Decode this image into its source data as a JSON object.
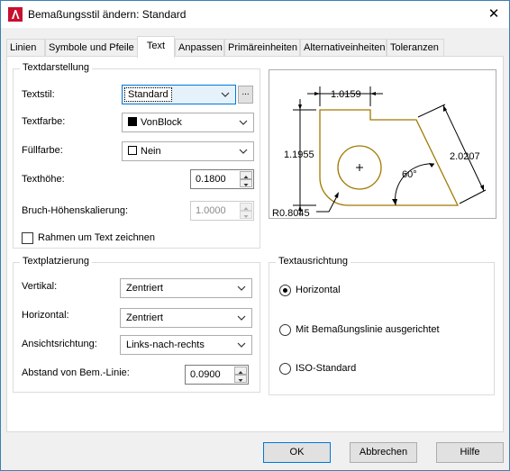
{
  "window": {
    "title": "Bemaßungsstil ändern: Standard",
    "close": "✕",
    "app_icon": "autocad-logo-icon"
  },
  "tabs": [
    {
      "label": "Linien",
      "active": false
    },
    {
      "label": "Symbole und Pfeile",
      "active": false
    },
    {
      "label": "Text",
      "active": true
    },
    {
      "label": "Anpassen",
      "active": false
    },
    {
      "label": "Primäreinheiten",
      "active": false
    },
    {
      "label": "Alternativeinheiten",
      "active": false
    },
    {
      "label": "Toleranzen",
      "active": false
    }
  ],
  "textdarstellung": {
    "title": "Textdarstellung",
    "textstil": {
      "label": "Textstil:",
      "value": "Standard",
      "browse": "..."
    },
    "textfarbe": {
      "label": "Textfarbe:",
      "value": "VonBlock",
      "swatch": "#000000"
    },
    "fuellfarbe": {
      "label": "Füllfarbe:",
      "value": "Nein",
      "swatch": "#ffffff"
    },
    "texthoehe": {
      "label": "Texthöhe:",
      "value": "0.1800"
    },
    "bruch": {
      "label": "Bruch-Höhenskalierung:",
      "value": "1.0000"
    },
    "rahmen": {
      "label": "Rahmen um Text zeichnen",
      "checked": false
    }
  },
  "preview": {
    "dim_top": "1.0159",
    "dim_left": "1.1955",
    "dim_right": "2.0207",
    "dim_angle": "60°",
    "dim_radius": "R0.8045"
  },
  "textplatzierung": {
    "title": "Textplatzierung",
    "vertikal": {
      "label": "Vertikal:",
      "value": "Zentriert"
    },
    "horizontal": {
      "label": "Horizontal:",
      "value": "Zentriert"
    },
    "ansicht": {
      "label": "Ansichtsrichtung:",
      "value": "Links-nach-rechts"
    },
    "abstand": {
      "label": "Abstand von Bem.-Linie:",
      "value": "0.0900"
    }
  },
  "textausrichtung": {
    "title": "Textausrichtung",
    "options": [
      {
        "label": "Horizontal",
        "selected": true
      },
      {
        "label": "Mit Bemaßungslinie ausgerichtet",
        "selected": false
      },
      {
        "label": "ISO-Standard",
        "selected": false
      }
    ]
  },
  "buttons": {
    "ok": "OK",
    "cancel": "Abbrechen",
    "help": "Hilfe"
  },
  "colors": {
    "accent": "#0078d7",
    "preview_geometry": "#a07800",
    "autocad_red": "#c8102e"
  }
}
